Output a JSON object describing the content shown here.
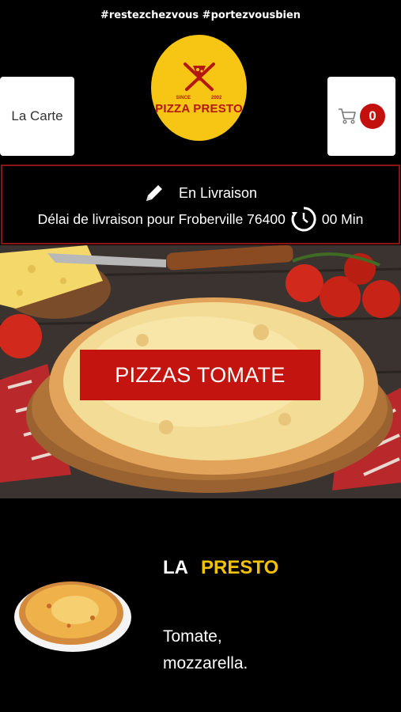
{
  "header": {
    "hashtags": "#restezchezvous #portezvousbien"
  },
  "nav": {
    "menu_label": "La Carte",
    "cart_count": "0"
  },
  "logo": {
    "since": "SINCE",
    "year": "2002",
    "name": "PIZZA PRESTO"
  },
  "delivery": {
    "mode": "En Livraison",
    "delay_text": "Délai de livraison pour Froberville 76400",
    "delay_value": "00 Min"
  },
  "hero": {
    "category_label": "PIZZAS TOMATE"
  },
  "product": {
    "title_prefix": "LA",
    "title_name": "PRESTO",
    "description": "Tomate, mozzarella."
  },
  "colors": {
    "brand_red": "#c4140f",
    "brand_yellow": "#f7c514",
    "accent_yellow": "#f2c200"
  },
  "icons": {
    "cart": "cart-icon",
    "edit": "pencil-icon",
    "clock": "clock-icon"
  }
}
